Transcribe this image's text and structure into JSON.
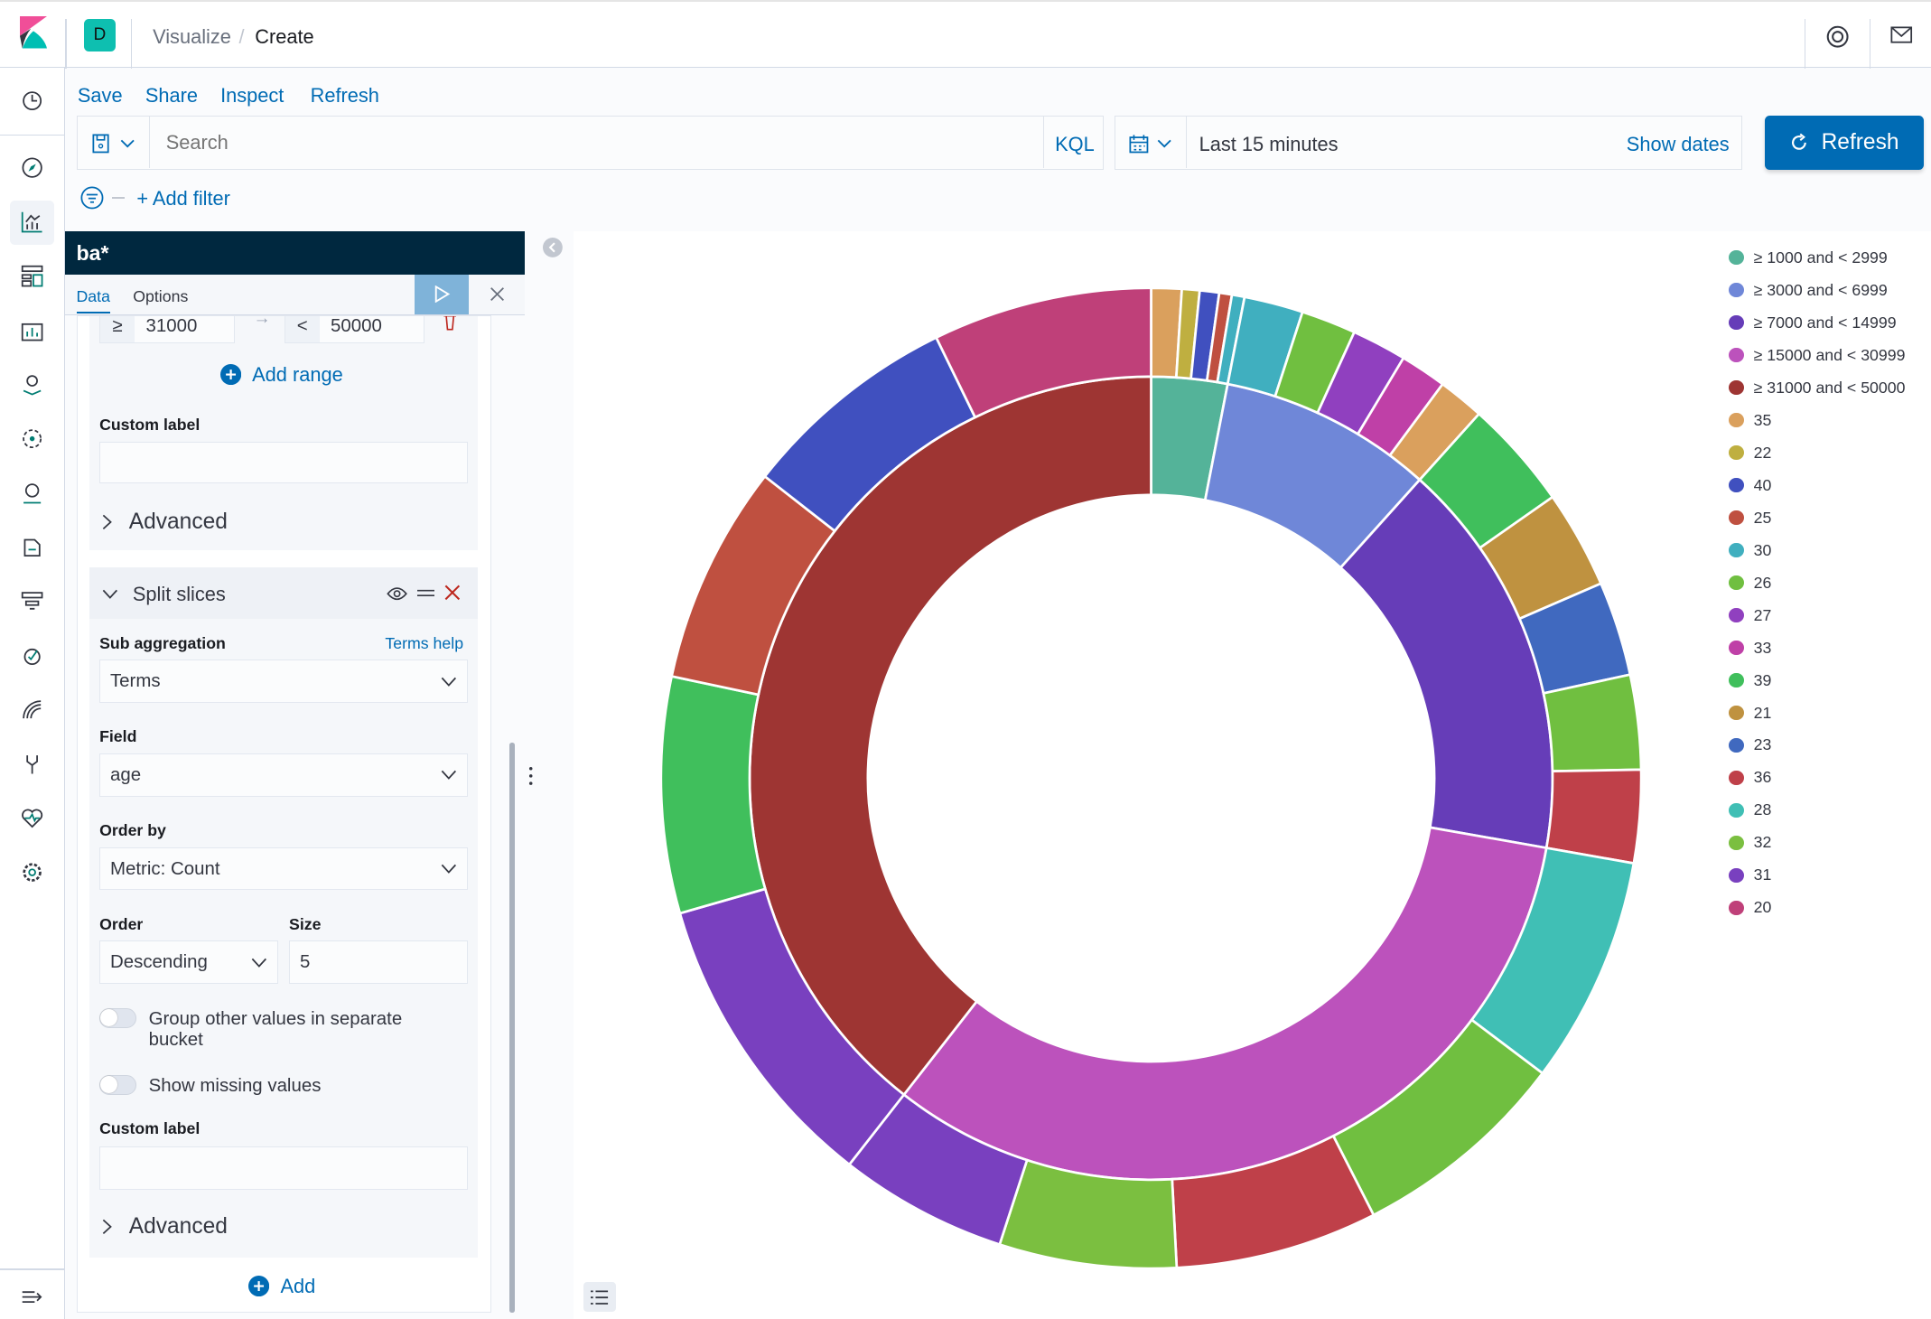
{
  "header": {
    "space_letter": "D",
    "breadcrumbs": [
      "Visualize",
      "Create"
    ]
  },
  "top_menu": [
    "Save",
    "Share",
    "Inspect",
    "Refresh"
  ],
  "query": {
    "placeholder": "Search",
    "language": "KQL",
    "time": "Last 15 minutes",
    "show_dates": "Show dates",
    "refresh": "Refresh",
    "add_filter": "+ Add filter"
  },
  "editor": {
    "index_pattern": "ba*",
    "tabs": [
      "Data",
      "Options"
    ],
    "range_row": {
      "from_op": "≥",
      "from": "31000",
      "to_op": "<",
      "to": "50000"
    },
    "add_range": "Add range",
    "custom_label": "Custom label",
    "advanced": "Advanced",
    "split": {
      "title": "Split slices",
      "sub_agg_label": "Sub aggregation",
      "terms_help": "Terms help",
      "sub_agg": "Terms",
      "field_label": "Field",
      "field": "age",
      "order_by_label": "Order by",
      "order_by": "Metric: Count",
      "order_label": "Order",
      "order": "Descending",
      "size_label": "Size",
      "size": "5",
      "group_other": "Group other values in separate bucket",
      "show_missing": "Show missing values",
      "custom_label": "Custom label",
      "advanced": "Advanced"
    },
    "add": "Add"
  },
  "chart_data": {
    "type": "pie",
    "donut": true,
    "legend_placement": "right",
    "legend": [
      {
        "label": "≥ 1000 and < 2999",
        "color": "#54B399"
      },
      {
        "label": "≥ 3000 and < 6999",
        "color": "#6F87D8"
      },
      {
        "label": "≥ 7000 and < 14999",
        "color": "#663DB8"
      },
      {
        "label": "≥ 15000 and < 30999",
        "color": "#BC52BC"
      },
      {
        "label": "≥ 31000 and < 50000",
        "color": "#9E3533"
      },
      {
        "label": "35",
        "color": "#DAA05D"
      },
      {
        "label": "22",
        "color": "#BFAF40"
      },
      {
        "label": "40",
        "color": "#4050BF"
      },
      {
        "label": "25",
        "color": "#BF5040"
      },
      {
        "label": "30",
        "color": "#40AFBF"
      },
      {
        "label": "26",
        "color": "#70BF40"
      },
      {
        "label": "27",
        "color": "#9040BF"
      },
      {
        "label": "33",
        "color": "#BF40A7"
      },
      {
        "label": "39",
        "color": "#40BF5C"
      },
      {
        "label": "21",
        "color": "#BF9240"
      },
      {
        "label": "23",
        "color": "#4069BF"
      },
      {
        "label": "36",
        "color": "#BF4049"
      },
      {
        "label": "28",
        "color": "#40BFB5"
      },
      {
        "label": "32",
        "color": "#7BBF40"
      },
      {
        "label": "31",
        "color": "#7940BF"
      },
      {
        "label": "20",
        "color": "#BF4079"
      }
    ],
    "inner": [
      {
        "label": "≥ 1000 and < 2999",
        "value": 11
      },
      {
        "label": "≥ 3000 and < 6999",
        "value": 31
      },
      {
        "label": "≥ 7000 and < 14999",
        "value": 58
      },
      {
        "label": "≥ 15000 and < 30999",
        "value": 118
      },
      {
        "label": "≥ 31000 and < 50000",
        "value": 142
      }
    ],
    "outer": [
      [
        {
          "label": "35",
          "value": 3.6
        },
        {
          "label": "22",
          "value": 2.1
        },
        {
          "label": "40",
          "value": 2.3
        },
        {
          "label": "25",
          "value": 1.5
        },
        {
          "label": "30",
          "value": 1.5
        }
      ],
      [
        {
          "label": "30",
          "value": 7
        },
        {
          "label": "26",
          "value": 6.5
        },
        {
          "label": "27",
          "value": 6.5
        },
        {
          "label": "33",
          "value": 5.5
        },
        {
          "label": "35",
          "value": 5.5
        }
      ],
      [
        {
          "label": "39",
          "value": 13
        },
        {
          "label": "21",
          "value": 11.6
        },
        {
          "label": "23",
          "value": 11.2
        },
        {
          "label": "26",
          "value": 11.2
        },
        {
          "label": "36",
          "value": 11
        }
      ],
      [
        {
          "label": "28",
          "value": 27
        },
        {
          "label": "26",
          "value": 26
        },
        {
          "label": "36",
          "value": 24
        },
        {
          "label": "32",
          "value": 21
        },
        {
          "label": "31",
          "value": 20
        }
      ],
      [
        {
          "label": "31",
          "value": 36
        },
        {
          "label": "39",
          "value": 28
        },
        {
          "label": "25",
          "value": 26
        },
        {
          "label": "40",
          "value": 26
        },
        {
          "label": "20",
          "value": 26
        }
      ]
    ]
  }
}
